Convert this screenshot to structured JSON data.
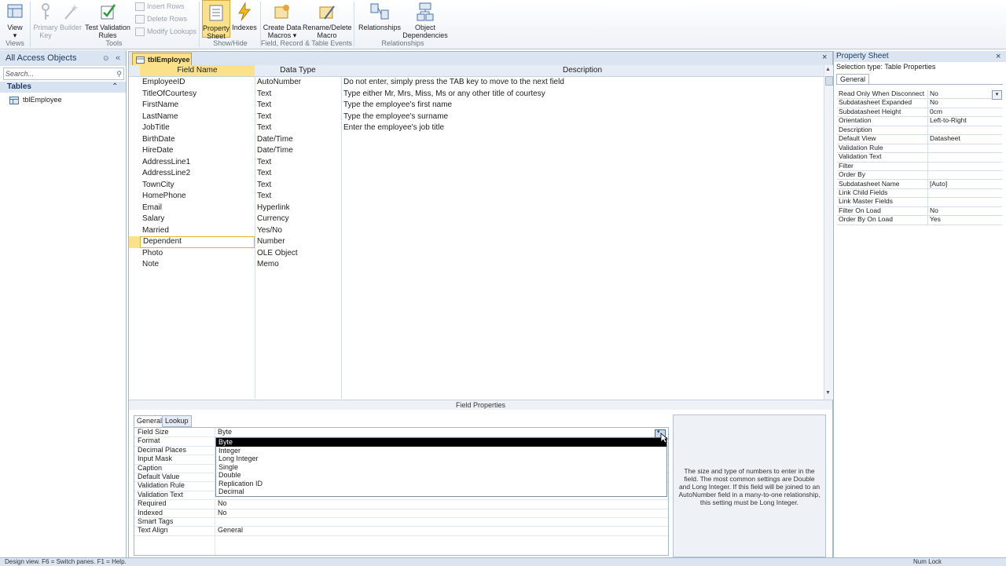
{
  "ribbon": {
    "buttons": [
      {
        "label": "View",
        "sub": "▾",
        "disabled": false
      },
      {
        "label": "Primary",
        "sub": "Key",
        "disabled": true
      },
      {
        "label": "Builder",
        "sub": "",
        "disabled": true
      },
      {
        "label": "Test Validation",
        "sub": "Rules",
        "disabled": false
      },
      {
        "label": "Property",
        "sub": "Sheet",
        "disabled": false
      },
      {
        "label": "Indexes",
        "sub": "",
        "disabled": false
      },
      {
        "label": "Create Data",
        "sub": "Macros ▾",
        "disabled": false
      },
      {
        "label": "Rename/Delete",
        "sub": "Macro",
        "disabled": false
      },
      {
        "label": "Relationships",
        "sub": "",
        "disabled": false
      },
      {
        "label": "Object",
        "sub": "Dependencies",
        "disabled": false
      }
    ],
    "small": [
      "Insert Rows",
      "Delete Rows",
      "Modify Lookups"
    ],
    "groups": [
      "Views",
      "Tools",
      "Show/Hide",
      "Field, Record & Table Events",
      "Relationships"
    ]
  },
  "nav": {
    "title": "All Access Objects",
    "search_placeholder": "Search...",
    "group": "Tables",
    "items": [
      "tblEmployee"
    ]
  },
  "document": {
    "tab": "tblEmployee",
    "headers": {
      "field": "Field Name",
      "type": "Data Type",
      "desc": "Description"
    },
    "rows": [
      {
        "field": "EmployeeID",
        "type": "AutoNumber",
        "desc": "Do not enter, simply press the TAB key to move to the next field",
        "key": true
      },
      {
        "field": "TitleOfCourtesy",
        "type": "Text",
        "desc": "Type either Mr, Mrs, Miss, Ms or any other title of courtesy"
      },
      {
        "field": "FirstName",
        "type": "Text",
        "desc": "Type the employee's first name"
      },
      {
        "field": "LastName",
        "type": "Text",
        "desc": "Type the employee's surname"
      },
      {
        "field": "JobTitle",
        "type": "Text",
        "desc": "Enter the employee's job title"
      },
      {
        "field": "BirthDate",
        "type": "Date/Time",
        "desc": ""
      },
      {
        "field": "HireDate",
        "type": "Date/Time",
        "desc": ""
      },
      {
        "field": "AddressLine1",
        "type": "Text",
        "desc": ""
      },
      {
        "field": "AddressLine2",
        "type": "Text",
        "desc": ""
      },
      {
        "field": "TownCity",
        "type": "Text",
        "desc": ""
      },
      {
        "field": "HomePhone",
        "type": "Text",
        "desc": ""
      },
      {
        "field": "Email",
        "type": "Hyperlink",
        "desc": ""
      },
      {
        "field": "Salary",
        "type": "Currency",
        "desc": ""
      },
      {
        "field": "Married",
        "type": "Yes/No",
        "desc": ""
      },
      {
        "field": "Dependent",
        "type": "Number",
        "desc": "",
        "selected": true
      },
      {
        "field": "Photo",
        "type": "OLE Object",
        "desc": ""
      },
      {
        "field": "Note",
        "type": "Memo",
        "desc": ""
      }
    ]
  },
  "field_properties": {
    "title": "Field Properties",
    "tabs": [
      "General",
      "Lookup"
    ],
    "props": [
      {
        "label": "Field Size",
        "value": "Byte"
      },
      {
        "label": "Format",
        "value": ""
      },
      {
        "label": "Decimal Places",
        "value": ""
      },
      {
        "label": "Input Mask",
        "value": ""
      },
      {
        "label": "Caption",
        "value": ""
      },
      {
        "label": "Default Value",
        "value": ""
      },
      {
        "label": "Validation Rule",
        "value": ""
      },
      {
        "label": "Validation Text",
        "value": ""
      },
      {
        "label": "Required",
        "value": "No"
      },
      {
        "label": "Indexed",
        "value": "No"
      },
      {
        "label": "Smart Tags",
        "value": ""
      },
      {
        "label": "Text Align",
        "value": "General"
      }
    ],
    "dropdown_options": [
      "Byte",
      "Integer",
      "Long Integer",
      "Single",
      "Double",
      "Replication ID",
      "Decimal"
    ],
    "dropdown_selected": "Byte",
    "help": "The size and type of numbers to enter in the field. The most common settings are Double and Long Integer. If this field will be joined to an AutoNumber field in a many-to-one relationship, this setting must be Long Integer."
  },
  "property_sheet": {
    "title": "Property Sheet",
    "selection_type": "Selection type:  Table Properties",
    "tab": "General",
    "rows": [
      {
        "label": "Read Only When Disconnect",
        "value": "No"
      },
      {
        "label": "Subdatasheet Expanded",
        "value": "No"
      },
      {
        "label": "Subdatasheet Height",
        "value": "0cm"
      },
      {
        "label": "Orientation",
        "value": "Left-to-Right"
      },
      {
        "label": "Description",
        "value": ""
      },
      {
        "label": "Default View",
        "value": "Datasheet"
      },
      {
        "label": "Validation Rule",
        "value": ""
      },
      {
        "label": "Validation Text",
        "value": ""
      },
      {
        "label": "Filter",
        "value": ""
      },
      {
        "label": "Order By",
        "value": ""
      },
      {
        "label": "Subdatasheet Name",
        "value": "[Auto]"
      },
      {
        "label": "Link Child Fields",
        "value": ""
      },
      {
        "label": "Link Master Fields",
        "value": ""
      },
      {
        "label": "Filter On Load",
        "value": "No"
      },
      {
        "label": "Order By On Load",
        "value": "Yes"
      }
    ]
  },
  "status": {
    "left": "Design view.  F6 = Switch panes.  F1 = Help.",
    "right": "Num Lock"
  },
  "colors": {
    "accent": "#fbe18a",
    "selected_border": "#e2b13a",
    "header_bg": "#dbe5f1"
  }
}
